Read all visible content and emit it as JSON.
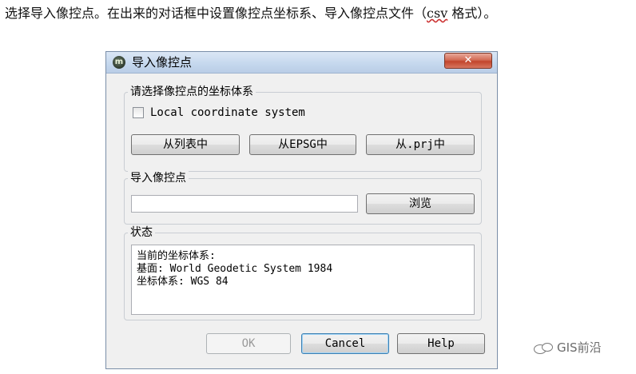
{
  "caption": {
    "prefix": "选择导入像控点。在出来的对话框中设置像控点坐标系、导入像控点文件（",
    "csv": "csv",
    "suffix": "格式）。"
  },
  "dialog": {
    "title": "导入像控点",
    "app_icon_glyph": "m",
    "close_glyph": "✕",
    "crs_group": {
      "label": "请选择像控点的坐标体系",
      "checkbox_label": "Local coordinate system",
      "checkbox_checked": false,
      "btn_from_list": "从列表中",
      "btn_from_epsg": "从EPSG中",
      "btn_from_prj": "从.prj中"
    },
    "import_group": {
      "label": "导入像控点",
      "path_value": "",
      "btn_browse": "浏览"
    },
    "status_group": {
      "label": "状态",
      "lines": "当前的坐标体系:\n基面: World Geodetic System 1984\n坐标体系: WGS 84"
    },
    "footer": {
      "ok": "OK",
      "cancel": "Cancel",
      "help": "Help"
    }
  },
  "watermark": "GIS前沿",
  "colors": {
    "dialog_bg": "#f0f0f0",
    "titlebar": "#c6d8ee",
    "close_button": "#c2452c",
    "focus_border": "#3c7fb1"
  },
  "icons": [
    "app-logo-icon",
    "close-icon",
    "wechat-icon"
  ]
}
